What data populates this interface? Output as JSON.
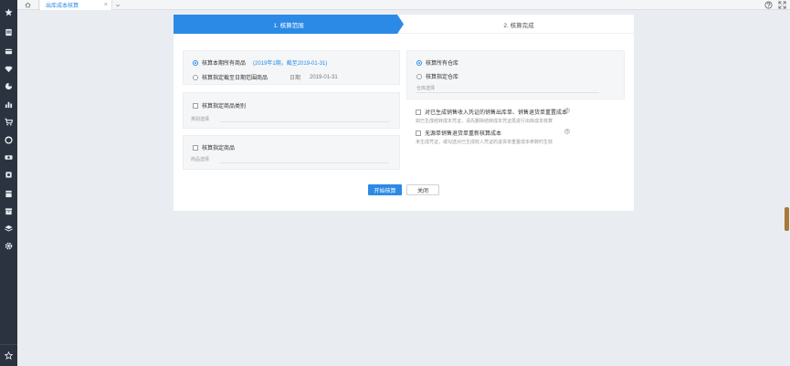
{
  "tabs": {
    "active_label": "出库成本核算",
    "close_glyph": "×"
  },
  "steps": {
    "step1": "1. 核算范围",
    "step2": "2. 核算完成"
  },
  "range": {
    "option_all": "核算本期所有商品",
    "option_all_hint": "(2019年1期，截至2019-01-31)",
    "option_date": "核算指定截至日期范围商品",
    "date_label": "日期",
    "date_value": "2019-01-31"
  },
  "category": {
    "checkbox_label": "核算指定商品类别",
    "field_label": "类别选择"
  },
  "goods": {
    "checkbox_label": "核算指定商品",
    "field_label": "商品选择"
  },
  "warehouse": {
    "option_all": "核算所有仓库",
    "option_specific": "核算指定仓库",
    "field_label": "仓库选择"
  },
  "options": {
    "opt1_label": "对已生成销售收入凭证的销售出库单、销售退货单重置成本",
    "opt1_desc": "如已生成结转成本凭证，请先删除结转成本凭证再进行出库成本核算",
    "opt2_label": "无源单销售退货单重新核算成本",
    "opt2_desc": "未生成凭证，或勾选对已生成收入凭证的退货单重置成本参数时生效"
  },
  "buttons": {
    "start": "开始核算",
    "close": "关闭"
  },
  "colors": {
    "accent": "#2b8ae6",
    "sidebar": "#2c3340"
  }
}
